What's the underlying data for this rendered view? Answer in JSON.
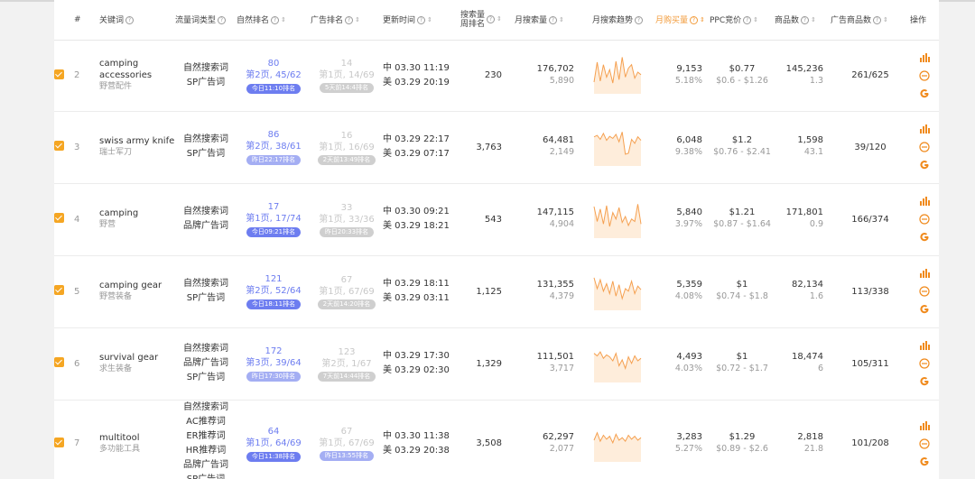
{
  "header": {
    "index": "#",
    "keyword": "关键词",
    "traffic_type": "流量词类型",
    "natural_rank": "自然排名",
    "ad_rank": "广告排名",
    "update_time": "更新时间",
    "search_rank_line1": "搜索量",
    "search_rank_line2": "周排名",
    "monthly_search": "月搜索量",
    "monthly_trend": "月搜索趋势",
    "monthly_purchase": "月购买量",
    "ppc": "PPC竞价",
    "products": "商品数",
    "ad_products": "广告商品数",
    "ops": "操作"
  },
  "colors": {
    "accent": "#f29a38",
    "rank_blue": "#6d7df0",
    "checkbox": "#f5a623",
    "google": "#f08a1c"
  },
  "rows": [
    {
      "index": "2",
      "kw_en": "camping accessories",
      "kw_cn": "野营配件",
      "types": [
        "自然搜索词",
        "SP广告词"
      ],
      "nat_num": "80",
      "nat_pos": "第2页, 45/62",
      "nat_badge": "今日11:10排名",
      "ad_num": "14",
      "ad_pos": "第1页, 14/69",
      "ad_badge": "5天前14:4排名",
      "upd_cn": "中 03.30 11:19",
      "upd_us": "美 03.29 20:19",
      "search_rank": "230",
      "monthly": "176,702",
      "monthly_sub": "5,890",
      "purchase": "9,153",
      "purchase_pct": "5.18%",
      "ppc": "$0.77",
      "ppc_range": "$0.6 - $1.26",
      "products": "145,236",
      "products_sub": "1.3",
      "ad_products": "261/625",
      "trend": [
        20,
        60,
        22,
        55,
        30,
        45,
        18,
        62,
        25,
        70,
        30,
        48,
        55,
        28,
        40,
        35
      ]
    },
    {
      "index": "3",
      "kw_en": "swiss army knife",
      "kw_cn": "瑞士军刀",
      "types": [
        "自然搜索词",
        "SP广告词"
      ],
      "nat_num": "86",
      "nat_pos": "第2页, 38/61",
      "nat_badge": "昨日22:17排名",
      "ad_num": "16",
      "ad_pos": "第1页, 16/69",
      "ad_badge": "2天前13:49排名",
      "upd_cn": "中 03.29 22:17",
      "upd_us": "美 03.29 07:17",
      "search_rank": "3,763",
      "monthly": "64,481",
      "monthly_sub": "2,149",
      "purchase": "6,048",
      "purchase_pct": "9.38%",
      "ppc": "$1.2",
      "ppc_range": "$0.76 - $2.41",
      "products": "1,598",
      "products_sub": "43.1",
      "ad_products": "39/120",
      "trend": [
        55,
        58,
        50,
        62,
        48,
        56,
        52,
        60,
        45,
        65,
        20,
        22,
        50,
        42,
        55,
        48
      ]
    },
    {
      "index": "4",
      "kw_en": "camping",
      "kw_cn": "野营",
      "types": [
        "自然搜索词",
        "品牌广告词"
      ],
      "nat_num": "17",
      "nat_pos": "第1页, 17/74",
      "nat_badge": "今日09:21排名",
      "ad_num": "33",
      "ad_pos": "第1页, 33/36",
      "ad_badge": "昨日20:33排名",
      "upd_cn": "中 03.30 09:21",
      "upd_us": "美 03.29 18:21",
      "search_rank": "543",
      "monthly": "147,115",
      "monthly_sub": "4,904",
      "purchase": "5,840",
      "purchase_pct": "3.97%",
      "ppc": "$1.21",
      "ppc_range": "$0.87 - $1.64",
      "products": "171,801",
      "products_sub": "0.9",
      "ad_products": "166/374",
      "trend": [
        60,
        30,
        55,
        25,
        62,
        20,
        48,
        35,
        58,
        28,
        40,
        22,
        35,
        30,
        65,
        25
      ]
    },
    {
      "index": "5",
      "kw_en": "camping gear",
      "kw_cn": "野营装备",
      "types": [
        "自然搜索词",
        "SP广告词"
      ],
      "nat_num": "121",
      "nat_pos": "第2页, 52/64",
      "nat_badge": "今日18:11排名",
      "ad_num": "67",
      "ad_pos": "第1页, 67/69",
      "ad_badge": "2天前14:20排名",
      "upd_cn": "中 03.29 18:11",
      "upd_us": "美 03.29 03:11",
      "search_rank": "1,125",
      "monthly": "131,355",
      "monthly_sub": "4,379",
      "purchase": "5,359",
      "purchase_pct": "4.08%",
      "ppc": "$1",
      "ppc_range": "$0.74 - $1.8",
      "products": "82,134",
      "products_sub": "1.6",
      "ad_products": "113/338",
      "trend": [
        62,
        40,
        58,
        35,
        50,
        30,
        55,
        25,
        48,
        20,
        40,
        35,
        55,
        30,
        45,
        38
      ]
    },
    {
      "index": "6",
      "kw_en": "survival gear",
      "kw_cn": "求生装备",
      "types": [
        "自然搜索词",
        "品牌广告词",
        "SP广告词"
      ],
      "nat_num": "172",
      "nat_pos": "第3页, 39/64",
      "nat_badge": "昨日17:30排名",
      "ad_num": "123",
      "ad_pos": "第2页, 1/67",
      "ad_badge": "7天前14:44排名",
      "upd_cn": "中 03.29 17:30",
      "upd_us": "美 03.29 02:30",
      "search_rank": "1,329",
      "monthly": "111,501",
      "monthly_sub": "3,717",
      "purchase": "4,493",
      "purchase_pct": "4.03%",
      "ppc": "$1",
      "ppc_range": "$0.72 - $1.7",
      "products": "18,474",
      "products_sub": "6",
      "ad_products": "105/311",
      "trend": [
        55,
        50,
        58,
        45,
        52,
        48,
        40,
        55,
        30,
        42,
        25,
        48,
        35,
        50,
        40,
        45
      ]
    },
    {
      "index": "7",
      "kw_en": "multitool",
      "kw_cn": "多功能工具",
      "types": [
        "自然搜索词",
        "AC推荐词",
        "ER推荐词",
        "HR推荐词",
        "品牌广告词",
        "SP广告词"
      ],
      "nat_num": "64",
      "nat_pos": "第1页, 64/69",
      "nat_badge": "今日11:38排名",
      "ad_num": "67",
      "ad_pos": "第1页, 67/69",
      "ad_badge": "昨日13:55排名",
      "upd_cn": "中 03.30 11:38",
      "upd_us": "美 03.29 20:38",
      "search_rank": "3,508",
      "monthly": "62,297",
      "monthly_sub": "2,077",
      "purchase": "3,283",
      "purchase_pct": "5.27%",
      "ppc": "$1.29",
      "ppc_range": "$0.89 - $2.6",
      "products": "2,818",
      "products_sub": "21.8",
      "ad_products": "101/208",
      "trend": [
        40,
        55,
        38,
        50,
        42,
        48,
        35,
        52,
        40,
        45,
        38,
        50,
        42,
        48,
        40,
        45
      ]
    }
  ]
}
